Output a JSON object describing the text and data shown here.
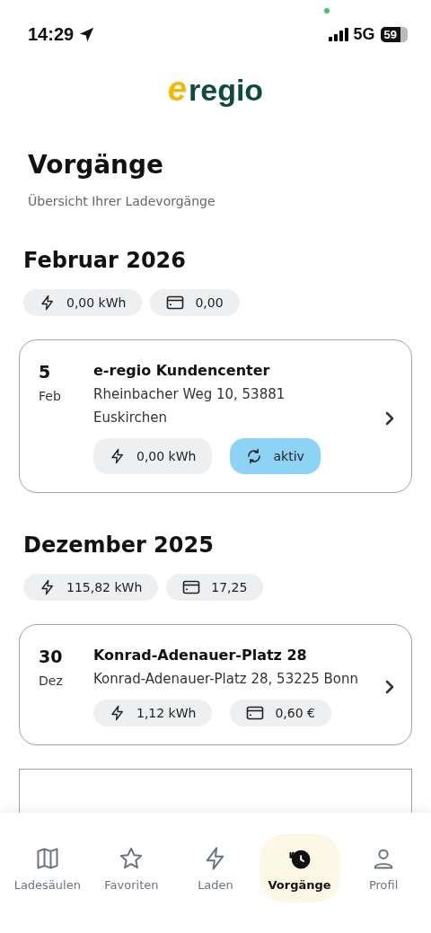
{
  "status_bar": {
    "time": "14:29",
    "network": "5G",
    "battery": "59"
  },
  "logo": {
    "mark": "e",
    "name": "regio"
  },
  "header": {
    "title": "Vorgänge",
    "subtitle": "Übersicht Ihrer Ladevorgänge"
  },
  "months": [
    {
      "title": "Februar 2026",
      "totals": [
        {
          "kind": "energy",
          "text": "0,00 kWh"
        },
        {
          "kind": "cost",
          "text": "0,00"
        }
      ],
      "sessions": [
        {
          "day": "5",
          "month": "Feb",
          "title": "e-regio Kundencenter",
          "address": "Rheinbacher Weg  10, 53881 Euskirchen",
          "chips": [
            {
              "kind": "energy",
              "text": "0,00 kWh"
            },
            {
              "kind": "status",
              "text": "aktiv"
            }
          ]
        }
      ]
    },
    {
      "title": "Dezember 2025",
      "totals": [
        {
          "kind": "energy",
          "text": "115,82 kWh"
        },
        {
          "kind": "cost",
          "text": "17,25"
        }
      ],
      "sessions": [
        {
          "day": "30",
          "month": "Dez",
          "title": "Konrad-Adenauer-Platz 28",
          "address": "Konrad-Adenauer-Platz  28, 53225 Bonn",
          "chips": [
            {
              "kind": "energy",
              "text": "1,12 kWh"
            },
            {
              "kind": "cost",
              "text": "0,60 €"
            }
          ]
        }
      ]
    }
  ],
  "tabs": [
    {
      "kind": "map",
      "label": "Ladesäulen",
      "selected": false
    },
    {
      "kind": "star",
      "label": "Favoriten",
      "selected": false
    },
    {
      "kind": "bolt",
      "label": "Laden",
      "selected": false
    },
    {
      "kind": "history",
      "label": "Vorgänge",
      "selected": true
    },
    {
      "kind": "person",
      "label": "Profil",
      "selected": false
    }
  ]
}
